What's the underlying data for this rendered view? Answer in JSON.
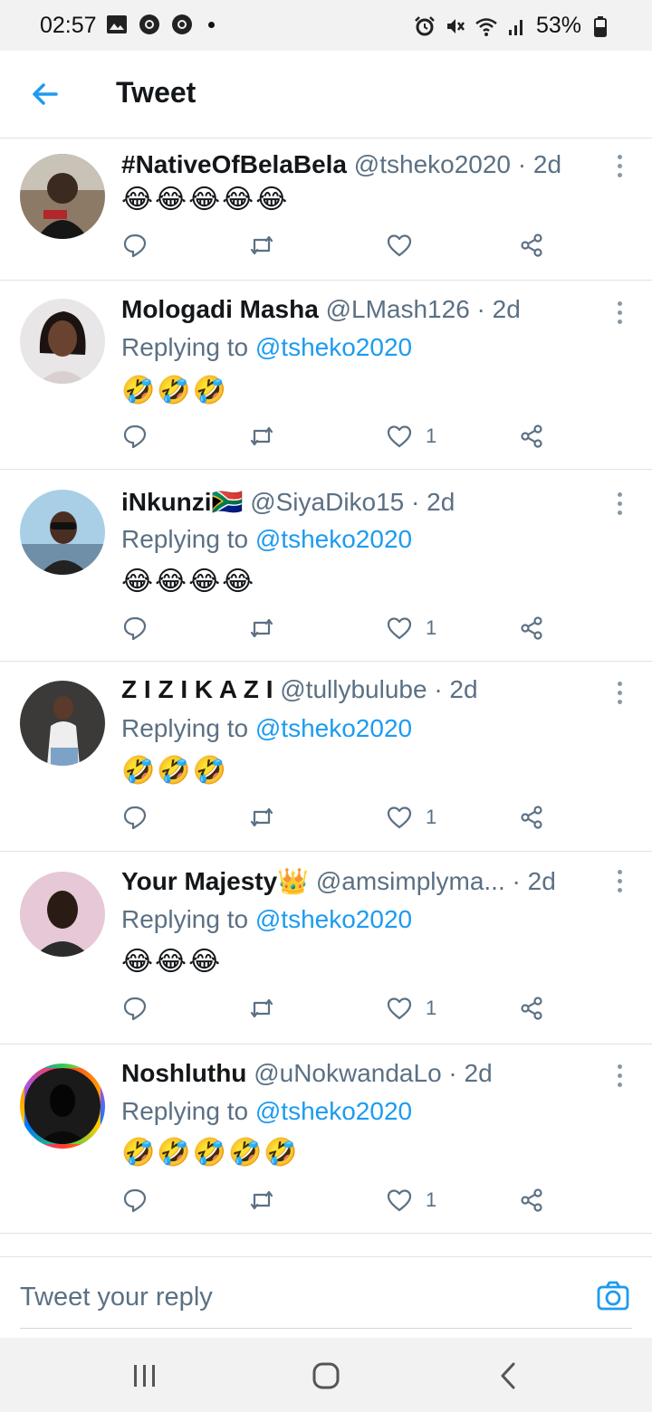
{
  "status_bar": {
    "time": "02:57",
    "battery": "53%",
    "left_icons": [
      "gallery-icon",
      "chrome-icon",
      "chrome-icon"
    ],
    "right_icons": [
      "alarm-icon",
      "mute-icon",
      "wifi-icon",
      "signal-icon",
      "battery-icon"
    ]
  },
  "header": {
    "title": "Tweet"
  },
  "tweets": [
    {
      "name": "#NativeOfBelaBela",
      "handle": "@tsheko2020 · 2d",
      "replying_label": "",
      "replying_to": "",
      "emojis": "😂😂😂😂😂",
      "likes": ""
    },
    {
      "name": "Mologadi Masha",
      "handle": "@LMash126 · 2d",
      "replying_label": "Replying to ",
      "replying_to": "@tsheko2020",
      "emojis": "🤣🤣🤣",
      "likes": "1"
    },
    {
      "name": "iNkunzi🇿🇦",
      "handle": "@SiyaDiko15 · 2d",
      "replying_label": "Replying to ",
      "replying_to": "@tsheko2020",
      "emojis": "😂😂😂😂",
      "likes": "1"
    },
    {
      "name": "Z I Z I K A Z I",
      "handle": "@tullybulube · 2d",
      "replying_label": "Replying to ",
      "replying_to": "@tsheko2020",
      "emojis": "🤣🤣🤣",
      "likes": "1"
    },
    {
      "name": "Your Majesty👑",
      "handle": "@amsimplyma...   · 2d",
      "replying_label": "Replying to ",
      "replying_to": "@tsheko2020",
      "emojis": "😂😂😂",
      "likes": "1"
    },
    {
      "name": "Noshluthu",
      "handle": "@uNokwandaLo · 2d",
      "replying_label": "Replying to ",
      "replying_to": "@tsheko2020",
      "emojis": "🤣🤣🤣🤣🤣",
      "likes": "1"
    }
  ],
  "reply_bar": {
    "placeholder": "Tweet your reply"
  },
  "colors": {
    "accent": "#1d9bf0",
    "secondary_text": "#5b7083",
    "divider": "#dde3e8"
  }
}
